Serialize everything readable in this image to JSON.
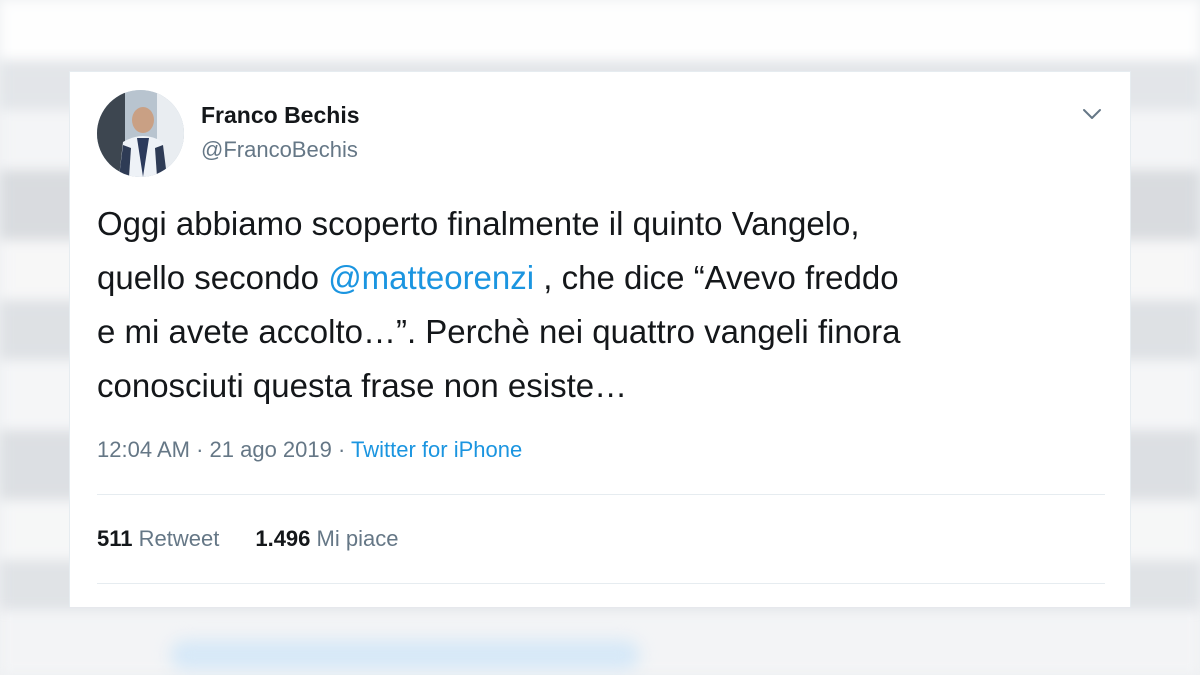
{
  "tweet": {
    "author_name": "Franco Bechis",
    "author_handle": "@FrancoBechis",
    "text_part1": "Oggi abbiamo scoperto finalmente il quinto Vangelo,\nquello secondo ",
    "mention": "@matteorenzi",
    "text_part2": " , che dice “Avevo freddo\ne mi avete accolto…”. Perchè nei quattro vangeli finora\nconosciuti questa frase non esiste…",
    "time": "12:04 AM",
    "separator1": " · ",
    "date": "21 ago 2019",
    "separator2": " · ",
    "source": "Twitter for iPhone",
    "retweet_count": "511",
    "retweet_label": "Retweet",
    "like_count": "1.496",
    "like_label": "Mi piace"
  },
  "icons": {
    "menu": "chevron-down-icon",
    "avatar": "avatar"
  },
  "colors": {
    "link": "#1b95e0",
    "text": "#14171a",
    "secondary": "#657786",
    "divider": "#e6ecf0"
  }
}
